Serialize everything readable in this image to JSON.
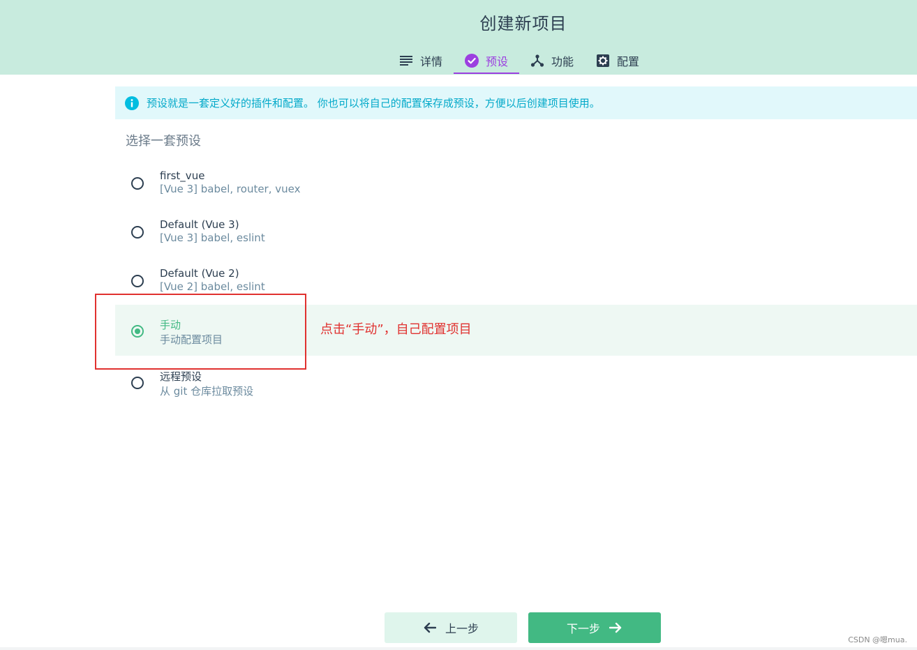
{
  "header": {
    "title": "创建新项目",
    "tabs": [
      {
        "label": "详情",
        "icon": "list-icon"
      },
      {
        "label": "预设",
        "icon": "check-circle-icon",
        "active": true
      },
      {
        "label": "功能",
        "icon": "fork-icon"
      },
      {
        "label": "配置",
        "icon": "gear-icon"
      }
    ]
  },
  "info": {
    "icon": "info-icon",
    "text": "预设就是一套定义好的插件和配置。 你也可以将自己的配置保存成预设，方便以后创建项目使用。"
  },
  "section_label": "选择一套预设",
  "presets": [
    {
      "name": "first_vue",
      "desc": "[Vue 3] babel, router, vuex",
      "selected": false
    },
    {
      "name": "Default (Vue 3)",
      "desc": "[Vue 3] babel, eslint",
      "selected": false
    },
    {
      "name": "Default (Vue 2)",
      "desc": "[Vue 2] babel, eslint",
      "selected": false
    },
    {
      "name": "手动",
      "desc": "手动配置项目",
      "selected": true
    },
    {
      "name": "远程预设",
      "desc": "从 git 仓库拉取预设",
      "selected": false
    }
  ],
  "annotation": "点击“手动”，自己配置项目",
  "buttons": {
    "prev": "上一步",
    "next": "下一步"
  },
  "watermark": "CSDN @嗯mua.",
  "colors": {
    "header_bg": "#c8ebde",
    "accent": "#42b983",
    "active_tab": "#9c3fe0",
    "info": "#03a9c9",
    "annotation": "#e0312f"
  }
}
